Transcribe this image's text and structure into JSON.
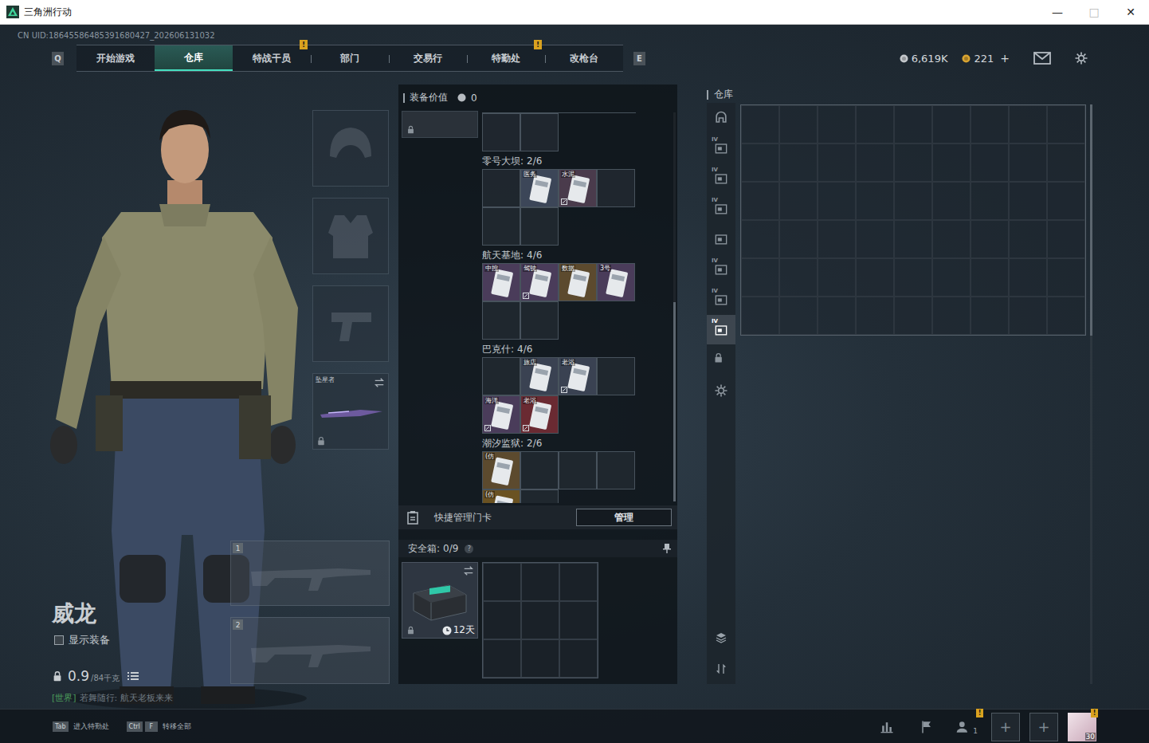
{
  "window": {
    "title": "三角洲行动",
    "controls": [
      {
        "glyph": "—",
        "disabled": false
      },
      {
        "glyph": "□",
        "disabled": true
      },
      {
        "glyph": "✕",
        "disabled": false
      }
    ]
  },
  "uid": "CN UID:18645586485391680427_202606131032",
  "alert_glyph": "!",
  "nav": {
    "left_key": "Q",
    "right_key": "E",
    "tabs": [
      {
        "label": "开始游戏",
        "selected": false,
        "alert": false
      },
      {
        "label": "仓库",
        "selected": true,
        "alert": false
      },
      {
        "label": "特战干员",
        "selected": false,
        "alert": true
      },
      {
        "label": "部门",
        "selected": false,
        "alert": false
      },
      {
        "label": "交易行",
        "selected": false,
        "alert": false
      },
      {
        "label": "特勤处",
        "selected": false,
        "alert": true
      },
      {
        "label": "改枪台",
        "selected": false,
        "alert": false
      }
    ]
  },
  "currency": [
    {
      "amount": "6,619K",
      "color": "#c4c8cc"
    },
    {
      "amount": "221",
      "color": "#d9a431",
      "add": "+"
    }
  ],
  "operator": {
    "name": "威龙",
    "show_gear": {
      "label": "显示装备",
      "checked": false
    },
    "weight": "0.9",
    "capacity": "/84千克",
    "chat": {
      "channel": "[世界]",
      "text": "若舞随行: 航天老板来来"
    }
  },
  "equipment": [
    {
      "kind": "helmet",
      "locked": false
    },
    {
      "kind": "armor",
      "locked": false
    },
    {
      "kind": "pistol",
      "locked": false
    },
    {
      "kind": "melee",
      "label": "坠星者",
      "locked": true
    }
  ],
  "weapons": [
    {
      "number": "1"
    },
    {
      "number": "2"
    }
  ],
  "loadout": {
    "label": "装备价值",
    "value": "0",
    "top_item_locked": true
  },
  "keycards": {
    "maps": [
      {
        "name": "零号大坝:",
        "count": "2/6",
        "slots": [
          {
            "filled": false
          },
          {
            "filled": true,
            "label": "医务",
            "color": "#3c4658",
            "marked": false
          },
          {
            "filled": true,
            "label": "水泥",
            "color": "#4a3b4c",
            "marked": true
          },
          {
            "filled": false
          },
          {
            "filled": false
          },
          {
            "filled": false
          }
        ]
      },
      {
        "name": "航天基地:",
        "count": "4/6",
        "slots": [
          {
            "filled": true,
            "label": "中控",
            "color": "#4a3c5a",
            "marked": false
          },
          {
            "filled": true,
            "label": "驾驶",
            "color": "#4a3c5a",
            "marked": true
          },
          {
            "filled": true,
            "label": "数据",
            "color": "#5c4a2e",
            "marked": false
          },
          {
            "filled": true,
            "label": "3号",
            "color": "#4a3c5a",
            "marked": false
          },
          {
            "filled": false
          },
          {
            "filled": false
          }
        ]
      },
      {
        "name": "巴克什:",
        "count": "4/6",
        "slots": [
          {
            "filled": false
          },
          {
            "filled": true,
            "label": "旅店",
            "color": "#3a4252",
            "marked": false
          },
          {
            "filled": true,
            "label": "老浴",
            "color": "#3a4252",
            "marked": true
          },
          {
            "filled": false
          },
          {
            "filled": true,
            "label": "海洋",
            "color": "#4a3c5a",
            "marked": true
          },
          {
            "filled": true,
            "label": "老浴",
            "color": "#6a2a32",
            "marked": true
          }
        ]
      },
      {
        "name": "潮汐监狱:",
        "count": "2/6",
        "slots": [
          {
            "filled": true,
            "label": "(仿",
            "color": "#5c4a2e",
            "marked": false
          },
          {
            "filled": false
          },
          {
            "filled": false
          },
          {
            "filled": false
          },
          {
            "filled": true,
            "label": "(仿",
            "color": "#6a5222",
            "marked": false
          },
          {
            "filled": false
          }
        ]
      }
    ]
  },
  "quick_manage": {
    "label": "快捷管理门卡",
    "button": "管理"
  },
  "safe_box": {
    "label": "安全箱:",
    "count": "0/9",
    "help": "?",
    "timer": "12天",
    "locked": true
  },
  "warehouse": {
    "title": "仓库",
    "tabs": [
      {
        "kind": "home",
        "selected": false
      },
      {
        "kind": "card",
        "badge": "IV",
        "selected": false
      },
      {
        "kind": "card",
        "badge": "IV",
        "selected": false
      },
      {
        "kind": "card",
        "badge": "IV",
        "selected": false
      },
      {
        "kind": "card",
        "selected": false
      },
      {
        "kind": "card",
        "badge": "IV",
        "selected": false
      },
      {
        "kind": "card",
        "badge": "IV",
        "selected": false
      },
      {
        "kind": "card",
        "badge": "IV",
        "selected": true
      },
      {
        "kind": "lock",
        "selected": false
      },
      {
        "kind": "gear",
        "selected": false
      }
    ],
    "tools": [
      {
        "kind": "layers"
      },
      {
        "kind": "sort"
      }
    ]
  },
  "footer": {
    "hints": [
      {
        "keys": [
          "Tab"
        ],
        "label": "进入特勤处"
      },
      {
        "keys": [
          "Ctrl",
          "F"
        ],
        "label": "转移全部"
      }
    ],
    "buttons": [
      {
        "kind": "stats"
      },
      {
        "kind": "flag"
      },
      {
        "kind": "friends",
        "count": "1",
        "alert": true
      },
      {
        "kind": "slot",
        "label": "+"
      },
      {
        "kind": "slot",
        "label": "+"
      },
      {
        "kind": "avatar",
        "level": "30",
        "alert": true
      }
    ]
  }
}
